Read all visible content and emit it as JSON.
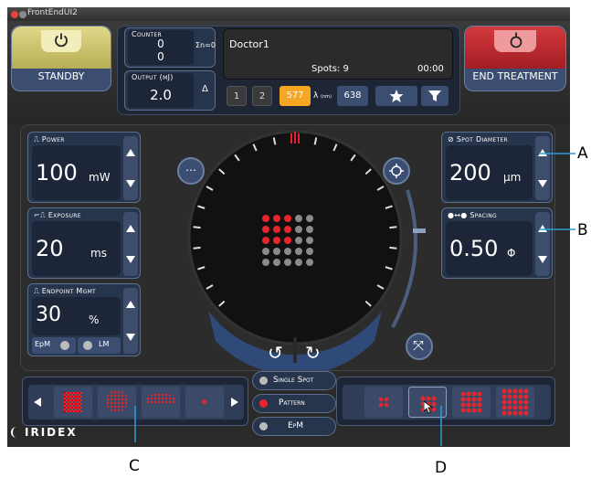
{
  "window": {
    "title": "FrontEndUI2"
  },
  "standby": {
    "label": "STANDBY"
  },
  "end_treatment": {
    "label": "END TREATMENT"
  },
  "counter": {
    "label": "Counter",
    "value_top": "0",
    "value_bottom": "0",
    "sum_label": "Σn=0"
  },
  "output": {
    "label": "Output (mJ)",
    "value": "2.0",
    "delta": "Δ"
  },
  "doctor": {
    "name": "Doctor1",
    "spots": "Spots: 9",
    "time": "00:00"
  },
  "wavelength": {
    "options": [
      "1",
      "2",
      "577",
      "638"
    ],
    "selected": "577",
    "label": "λ",
    "unit": "(nm)"
  },
  "power": {
    "label": "Power",
    "value": "100",
    "unit": "mW"
  },
  "exposure": {
    "label": "Exposure",
    "value": "20",
    "unit": "ms"
  },
  "endpoint": {
    "label": "Endpoint Mgmt",
    "value": "30",
    "unit": "%",
    "epm_label": "EpM",
    "lm_label": "LM"
  },
  "spot_diameter": {
    "label": "Spot Diameter",
    "value": "200",
    "unit": "µm"
  },
  "spacing": {
    "label": "Spacing",
    "value": "0.50",
    "unit": "Φ"
  },
  "modes": {
    "single_spot": "Single Spot",
    "pattern": "Pattern",
    "epm": "EpM"
  },
  "brand": {
    "logo": "IRIDEX"
  },
  "callouts": {
    "a": "A",
    "b": "B",
    "c": "C",
    "d": "D"
  },
  "colors": {
    "accent_orange": "#f5a623",
    "panel_blue": "#26344c",
    "standby_yellow": "#cfc56a",
    "end_red": "#c0282d",
    "laser_red": "#e8242c"
  },
  "icons": [
    "menu-dots-icon",
    "crosshair-icon",
    "rotate-left-icon",
    "rotate-right-icon",
    "collapse-icon",
    "star-icon",
    "funnel-icon",
    "power-icon"
  ]
}
